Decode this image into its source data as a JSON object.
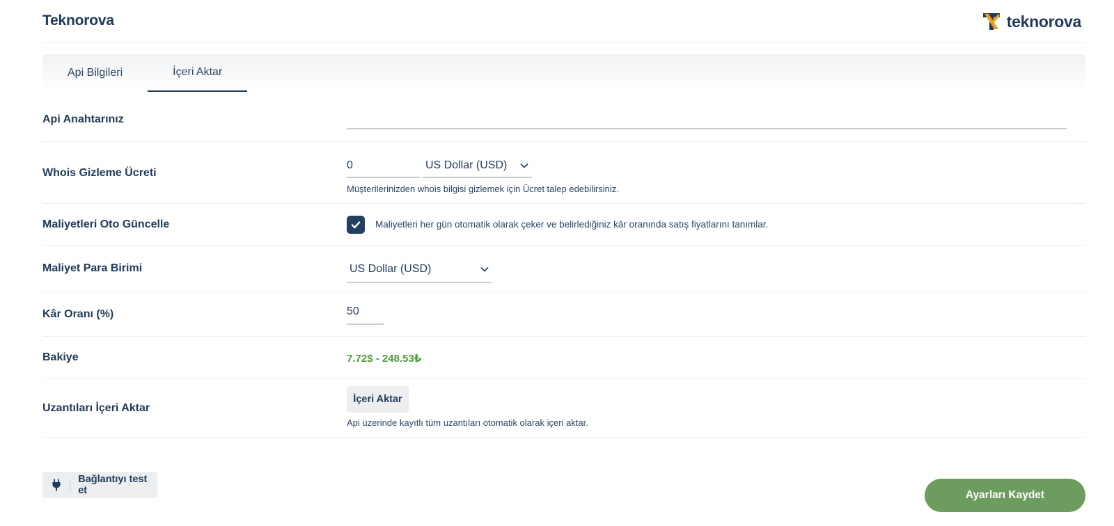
{
  "header": {
    "title": "Teknorova",
    "logo_text": "teknorova"
  },
  "tabs": [
    {
      "label": "Api Bilgileri",
      "active": false
    },
    {
      "label": "İçeri Aktar",
      "active": true
    }
  ],
  "form": {
    "api_key": {
      "label": "Api Anahtarınız",
      "value": ""
    },
    "whois": {
      "label": "Whois Gizleme Ücreti",
      "amount": "0",
      "currency": "US Dollar (USD)",
      "help": "Müşterilerinizden whois bilgisi gizlemek için Ücret talep edebilirsiniz."
    },
    "auto_update": {
      "label": "Maliyetleri Oto Güncelle",
      "checked": true,
      "text": "Maliyetleri her gün otomatik olarak çeker ve belirlediğiniz kâr oranında satış fiyatlarını tanımlar."
    },
    "cost_currency": {
      "label": "Maliyet Para Birimi",
      "value": "US Dollar (USD)"
    },
    "profit": {
      "label": "Kâr Oranı (%)",
      "value": "50"
    },
    "balance": {
      "label": "Bakiye",
      "value": "7.72$ - 248.53₺"
    },
    "import": {
      "label": "Uzantıları İçeri Aktar",
      "button": "İçeri Aktar",
      "help": "Api üzerinde kayıtlı tüm uzantıları otomatik olarak içeri aktar."
    }
  },
  "actions": {
    "test_connection": "Bağlantıyı test et",
    "save": "Ayarları Kaydet"
  },
  "colors": {
    "primary": "#1f3a5a",
    "success": "#4f9a3a",
    "save_button": "#6d9c5f",
    "logo_orange": "#f0a020"
  },
  "icons": {
    "chevron": "chevron-down-icon",
    "check": "check-icon",
    "plug": "plug-icon"
  }
}
